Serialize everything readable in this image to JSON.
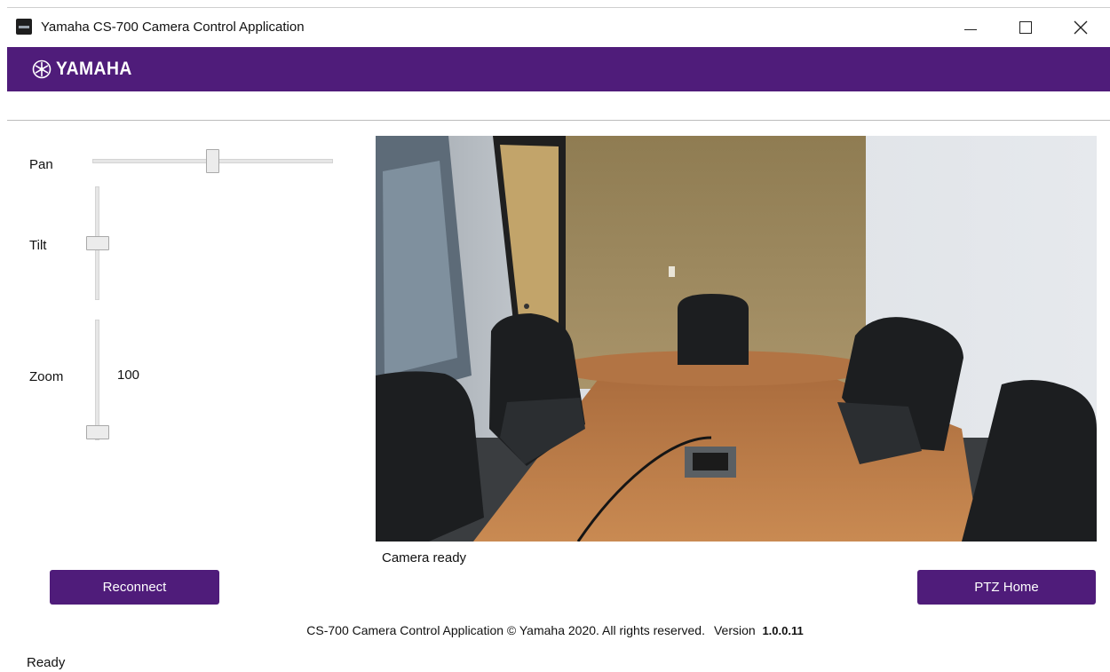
{
  "window": {
    "title": "Yamaha CS-700 Camera Control Application",
    "controls": {
      "minimize": "—",
      "maximize": "☐",
      "close": "✕"
    }
  },
  "brand": {
    "logo_text": "YAMAHA",
    "bar_color": "#4f1c7a",
    "logo_icon": "tuning-fork-emblem-icon"
  },
  "controls": {
    "pan": {
      "label": "Pan",
      "value_fraction": 0.5
    },
    "tilt": {
      "label": "Tilt",
      "value_fraction": 0.5
    },
    "zoom": {
      "label": "Zoom",
      "value": "100",
      "value_fraction": 0.0
    }
  },
  "camera": {
    "feed_description_icon": "conference-room-camera-feed",
    "status": "Camera ready"
  },
  "buttons": {
    "reconnect": "Reconnect",
    "ptz_home": "PTZ Home",
    "accent": "#4f1c7a"
  },
  "footer": {
    "copyright": "CS-700 Camera Control Application © Yamaha 2020. All rights reserved.",
    "version_label": "Version",
    "version_number": "1.0.0.11"
  },
  "statusbar": {
    "text": "Ready"
  }
}
